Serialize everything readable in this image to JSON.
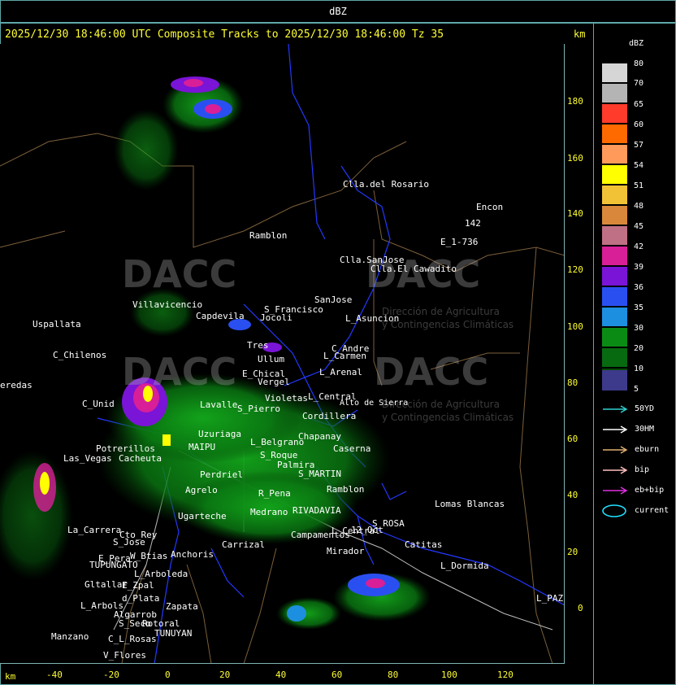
{
  "window_title": "dBZ",
  "header": "2025/12/30 18:46:00 UTC Composite Tracks to 2025/12/30 18:46:00 Tz 35",
  "units": {
    "top_right": "km",
    "bottom_left": "km"
  },
  "y_axis_km": [
    "180",
    "160",
    "140",
    "120",
    "100",
    "80",
    "60",
    "40",
    "20",
    "0"
  ],
  "x_axis_km": [
    "-40",
    "-20",
    "0",
    "20",
    "40",
    "60",
    "80",
    "100",
    "120"
  ],
  "places": [
    "Clla.del Rosario",
    "Encon",
    "Ramblon",
    "142",
    "E_1-736",
    "Clla.SanJose",
    "Clla.El Cawadito",
    "Villavicencio",
    "S_Francisco",
    "SanJose",
    "Uspallata",
    "Capdevila",
    "Jocoli",
    "L_Asuncion",
    "C_Chilenos",
    "Tres",
    "Ullum",
    "C_Andre",
    "L_Carmen",
    "eredas",
    "E_Chical",
    "Vergel",
    "L_Arenal",
    "C_Unid",
    "Violetas",
    "L_Central",
    "Alto de Sierra",
    "Lavalle",
    "S_Pierro",
    "Cordillera",
    "Uzuriaga",
    "Chapanay",
    "L_Belgrano",
    "Caserna",
    "Potrerillos",
    "MAIPU",
    "Las_Vegas",
    "Cacheuta",
    "S_Roque",
    "Palmira",
    "Perdriel",
    "S_MARTIN",
    "Agrelo",
    "Ramblon",
    "R_Pena",
    "Lomas Blancas",
    "Ugarteche",
    "RIVADAVIA",
    "Medrano",
    "S_ROSA",
    "La_Carrera",
    "Cto_Rey",
    "S_Jose",
    "Carrizal",
    "Campamentos",
    "12_Oct",
    "L_Central",
    "Catitas",
    "E_Pera",
    "W_Btias",
    "Anchoris",
    "TUPUNGATO",
    "Mirador",
    "L_Dormida",
    "L_Arboleda",
    "Gltallar",
    "E_Zpal",
    "d_Plata",
    "L_PAZ",
    "L_Arbols",
    "Zapata",
    "Algarrob",
    "S_Seco",
    "Rotoral",
    "TUNUYAN",
    "Manzano",
    "C_L_Rosas",
    "V_Flores"
  ],
  "watermark": {
    "brand": "DACC",
    "subtitle_line1": "Dirección de Agricultura",
    "subtitle_line2": "y Contingencias Climáticas"
  },
  "legend": {
    "title": "dBZ",
    "levels": [
      {
        "label": "80",
        "color": "#d6d6d6"
      },
      {
        "label": "70",
        "color": "#b4b4b4"
      },
      {
        "label": "65",
        "color": "#ff3b2b"
      },
      {
        "label": "60",
        "color": "#ff6a00"
      },
      {
        "label": "57",
        "color": "#ff9a5a"
      },
      {
        "label": "54",
        "color": "#ffff00"
      },
      {
        "label": "51",
        "color": "#f2c236"
      },
      {
        "label": "48",
        "color": "#d9883b"
      },
      {
        "label": "45",
        "color": "#c07084"
      },
      {
        "label": "42",
        "color": "#d81f98"
      },
      {
        "label": "39",
        "color": "#7a14d6"
      },
      {
        "label": "36",
        "color": "#2a4ff0"
      },
      {
        "label": "35",
        "color": "#1c8fe0"
      },
      {
        "label": "30",
        "color": "#0a8c14"
      },
      {
        "label": "20",
        "color": "#076a10"
      },
      {
        "label": "10",
        "color": "#064a08"
      },
      {
        "label": "5",
        "color": "#3d3a8c"
      }
    ],
    "tracks": [
      {
        "label": "50YD",
        "color": "#30d0d0",
        "icon": "arrow-right-icon"
      },
      {
        "label": "30HM",
        "color": "#ffffff",
        "icon": "arrow-right-icon"
      },
      {
        "label": "eburn",
        "color": "#e0b070",
        "icon": "arrow-right-icon"
      },
      {
        "label": "bip",
        "color": "#ffc0c0",
        "icon": "arrow-right-icon"
      },
      {
        "label": "eb+bip",
        "color": "#e030e0",
        "icon": "arrow-right-icon"
      },
      {
        "label": "current",
        "color": "#20e0ff",
        "icon": "ellipse-icon"
      }
    ]
  }
}
